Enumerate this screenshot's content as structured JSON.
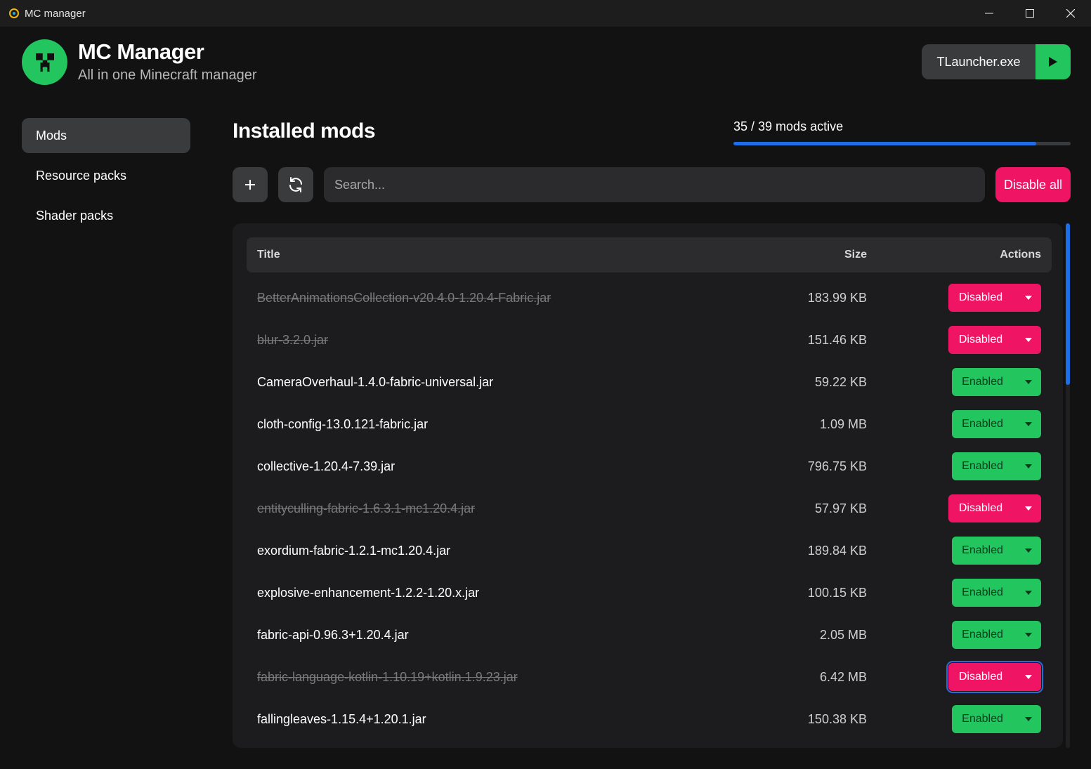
{
  "window": {
    "title": "MC manager"
  },
  "header": {
    "app_name": "MC Manager",
    "tagline": "All in one Minecraft manager",
    "launcher_label": "TLauncher.exe"
  },
  "sidebar": {
    "items": [
      {
        "label": "Mods",
        "active": true
      },
      {
        "label": "Resource packs",
        "active": false
      },
      {
        "label": "Shader packs",
        "active": false
      }
    ]
  },
  "main": {
    "title": "Installed mods",
    "active_summary": "35 / 39 mods active",
    "active_fraction": 0.897,
    "search_placeholder": "Search...",
    "disable_all_label": "Disable all"
  },
  "table": {
    "headers": {
      "title": "Title",
      "size": "Size",
      "actions": "Actions"
    },
    "rows": [
      {
        "name": "BetterAnimationsCollection-v20.4.0-1.20.4-Fabric.jar",
        "size": "183.99 KB",
        "status": "Disabled",
        "enabled": false
      },
      {
        "name": "blur-3.2.0.jar",
        "size": "151.46 KB",
        "status": "Disabled",
        "enabled": false
      },
      {
        "name": "CameraOverhaul-1.4.0-fabric-universal.jar",
        "size": "59.22 KB",
        "status": "Enabled",
        "enabled": true
      },
      {
        "name": "cloth-config-13.0.121-fabric.jar",
        "size": "1.09 MB",
        "status": "Enabled",
        "enabled": true
      },
      {
        "name": "collective-1.20.4-7.39.jar",
        "size": "796.75 KB",
        "status": "Enabled",
        "enabled": true
      },
      {
        "name": "entityculling-fabric-1.6.3.1-mc1.20.4.jar",
        "size": "57.97 KB",
        "status": "Disabled",
        "enabled": false
      },
      {
        "name": "exordium-fabric-1.2.1-mc1.20.4.jar",
        "size": "189.84 KB",
        "status": "Enabled",
        "enabled": true
      },
      {
        "name": "explosive-enhancement-1.2.2-1.20.x.jar",
        "size": "100.15 KB",
        "status": "Enabled",
        "enabled": true
      },
      {
        "name": "fabric-api-0.96.3+1.20.4.jar",
        "size": "2.05 MB",
        "status": "Enabled",
        "enabled": true
      },
      {
        "name": "fabric-language-kotlin-1.10.19+kotlin.1.9.23.jar",
        "size": "6.42 MB",
        "status": "Disabled",
        "enabled": false,
        "focused": true
      },
      {
        "name": "fallingleaves-1.15.4+1.20.1.jar",
        "size": "150.38 KB",
        "status": "Enabled",
        "enabled": true
      }
    ]
  },
  "colors": {
    "accent_green": "#22c55e",
    "accent_pink": "#f01465",
    "progress_blue": "#1d6fe8"
  }
}
